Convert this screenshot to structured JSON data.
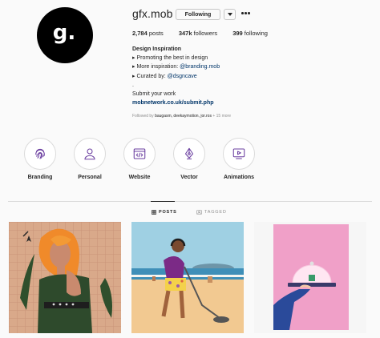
{
  "profile": {
    "avatar_letter": "g.",
    "username": "gfx.mob",
    "follow_button_label": "Following",
    "stats": {
      "posts_count": "2,784",
      "posts_label": "posts",
      "followers_count": "347k",
      "followers_label": "followers",
      "following_count": "399",
      "following_label": "following"
    },
    "bio": {
      "name": "Design Inspiration",
      "line1": "Promoting the best in design",
      "line2_prefix": "More inspiration: ",
      "line2_link": "@branding.mob",
      "line3_prefix": "Curated by: ",
      "line3_link": "@dsgncave",
      "line4": ".",
      "line5": "Submit your work",
      "website": "mobnetwork.co.uk/submit.php"
    },
    "followed_by": {
      "prefix": "Followed by ",
      "names": "baugasm, deekaymotion, jor.ros",
      "suffix": " + 15 more"
    }
  },
  "highlights": [
    {
      "label": "Branding",
      "icon": "fingerprint-icon"
    },
    {
      "label": "Personal",
      "icon": "user-icon"
    },
    {
      "label": "Website",
      "icon": "code-window-icon"
    },
    {
      "label": "Vector",
      "icon": "pen-nib-icon"
    },
    {
      "label": "Animations",
      "icon": "video-play-icon"
    }
  ],
  "tabs": {
    "posts": "POSTS",
    "tagged": "TAGGED"
  },
  "colors": {
    "background": "#fafafa",
    "accent_purple": "#6b3fa0",
    "link": "#003569",
    "secondary_text": "#8e8e8e"
  }
}
